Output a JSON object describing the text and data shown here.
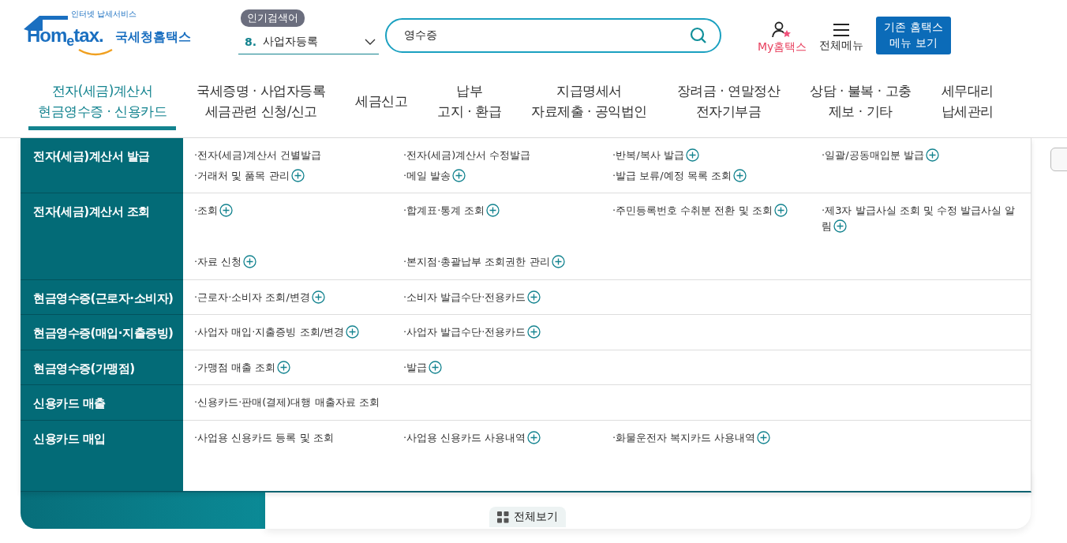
{
  "header": {
    "logo": {
      "tagline": "인터넷 납세서비스",
      "wordmark": "Hom$_{e}$tax.",
      "name": "국세청홈택스"
    },
    "popular": {
      "badge": "인기검색어",
      "rank": "8.",
      "keyword": "사업자등록"
    },
    "search": {
      "value": "영수증"
    },
    "my_hometax": "My홈택스",
    "all_menu": "전체메뉴",
    "classic_button": "기존 홈택스\n메뉴 보기"
  },
  "nav": [
    {
      "label": "전자(세금)계산서\n현금영수증 · 신용카드",
      "selected": true
    },
    {
      "label": "국세증명 · 사업자등록\n세금관련 신청/신고",
      "selected": false
    },
    {
      "label": "세금신고",
      "selected": false
    },
    {
      "label": "납부\n고지 · 환급",
      "selected": false
    },
    {
      "label": "지급명세서\n자료제출 · 공익법인",
      "selected": false
    },
    {
      "label": "장려금 · 연말정산\n전자기부금",
      "selected": false
    },
    {
      "label": "상담 · 불복 · 고충\n제보 · 기타",
      "selected": false
    },
    {
      "label": "세무대리\n납세관리",
      "selected": false
    }
  ],
  "mega_menu": [
    {
      "title": "전자(세금)계산서 발급",
      "items": [
        {
          "label": "·전자(세금)계산서 건별발급",
          "plus": false
        },
        {
          "label": "·전자(세금)계산서 수정발급",
          "plus": false
        },
        {
          "label": "·반복/복사 발급",
          "plus": true
        },
        {
          "label": "·일괄/공동매입분 발급",
          "plus": true
        },
        {
          "label": "·거래처 및 품목 관리",
          "plus": true
        },
        {
          "label": "·메일 발송",
          "plus": true
        },
        {
          "label": "·발급 보류/예정 목록 조회",
          "plus": true
        }
      ]
    },
    {
      "title": "전자(세금)계산서 조회",
      "items": [
        {
          "label": "·조회",
          "plus": true
        },
        {
          "label": "·합계표·통계 조회",
          "plus": true
        },
        {
          "label": "·주민등록번호 수취분 전환 및 조회",
          "plus": true
        },
        {
          "label": "·제3자 발급사실 조회 및 수정 발급사실 알림",
          "plus": true
        },
        {
          "label": "·자료 신청",
          "plus": true
        },
        {
          "label": "·본지점·총괄납부 조회권한 관리",
          "plus": true
        }
      ]
    },
    {
      "title": "현금영수증(근로자·소비자)",
      "items": [
        {
          "label": "·근로자·소비자 조회/변경",
          "plus": true
        },
        {
          "label": "·소비자 발급수단·전용카드",
          "plus": true
        }
      ]
    },
    {
      "title": "현금영수증(매입·지출증빙)",
      "items": [
        {
          "label": "·사업자 매입·지출증빙 조회/변경",
          "plus": true
        },
        {
          "label": "·사업자 발급수단·전용카드",
          "plus": true
        }
      ]
    },
    {
      "title": "현금영수증(가맹점)",
      "items": [
        {
          "label": "·가맹점 매출 조회",
          "plus": true
        },
        {
          "label": "·발급",
          "plus": true
        }
      ]
    },
    {
      "title": "신용카드 매출",
      "items": [
        {
          "label": "·신용카드·판매(결제)대행 매출자료 조회",
          "plus": false
        }
      ]
    },
    {
      "title": "신용카드 매입",
      "items": [
        {
          "label": "·사업용 신용카드 등록 및 조회",
          "plus": false
        },
        {
          "label": "·사업용 신용카드 사용내역",
          "plus": true
        },
        {
          "label": "·화물운전자 복지카드 사용내역",
          "plus": true
        }
      ]
    }
  ],
  "view_all_button": "전체보기"
}
